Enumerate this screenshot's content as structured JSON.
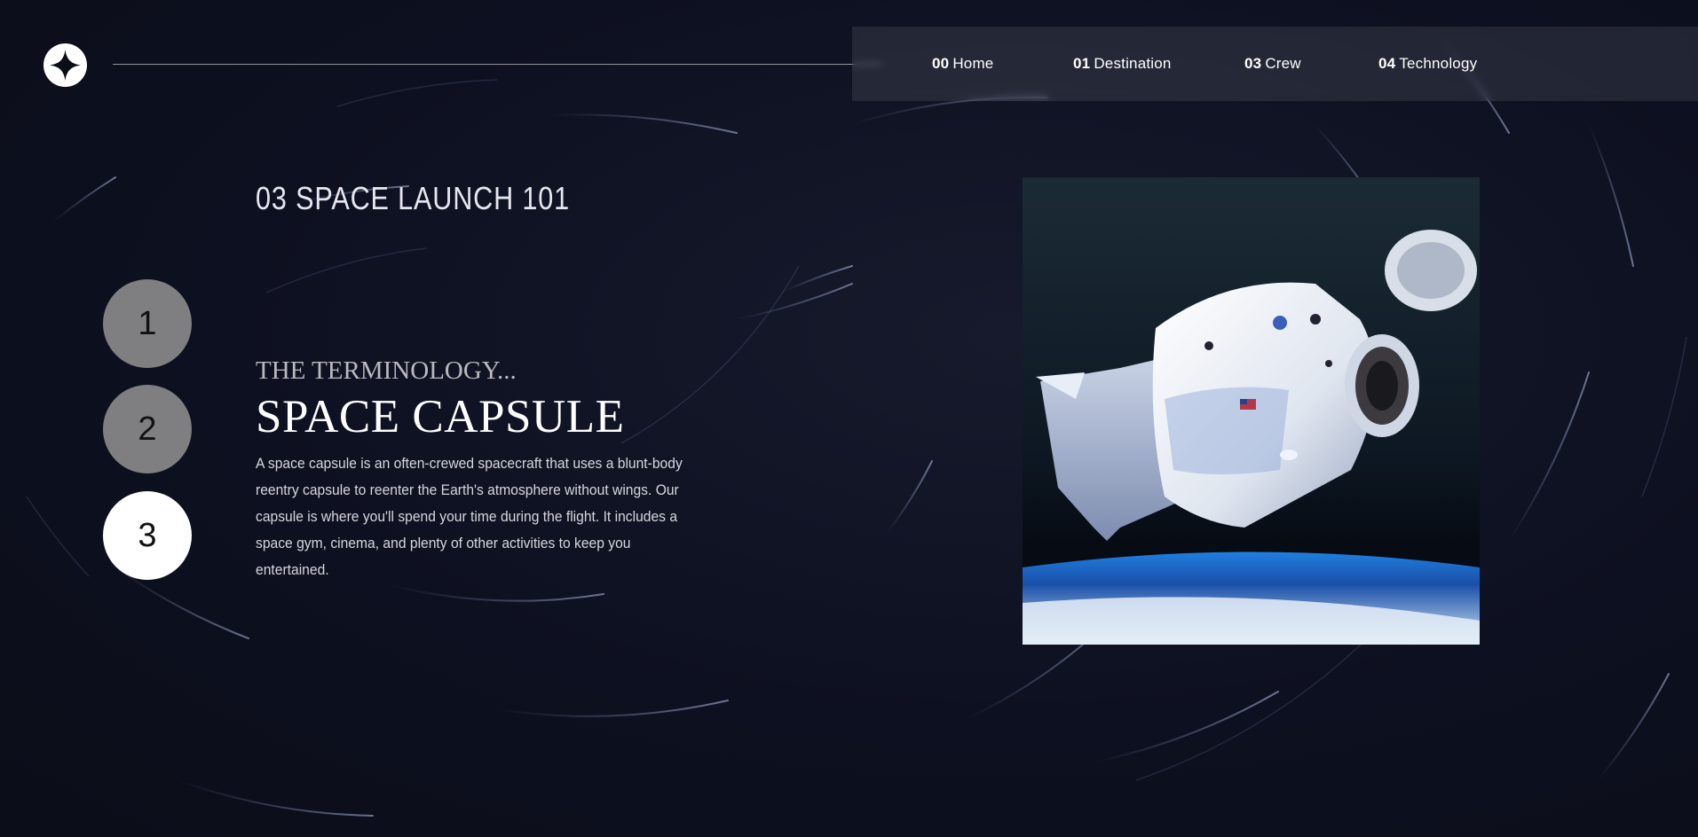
{
  "nav": {
    "items": [
      {
        "num": "00",
        "label": "Home"
      },
      {
        "num": "01",
        "label": "Destination"
      },
      {
        "num": "03",
        "label": "Crew"
      },
      {
        "num": "04",
        "label": "Technology"
      }
    ]
  },
  "page": {
    "heading": "03 SPACE LAUNCH 101"
  },
  "steps": [
    "1",
    "2",
    "3"
  ],
  "active_step": "3",
  "technology": {
    "label": "THE TERMINOLOGY...",
    "title": "SPACE CAPSULE",
    "description": "A space capsule is an often-crewed spacecraft that uses a blunt-body reentry capsule to reenter the Earth's atmosphere without wings. Our capsule is where you'll spend your time during the flight. It includes a space gym, cinema, and plenty of other activities to keep you entertained."
  },
  "icons": {
    "logo": "star-logo-icon"
  },
  "colors": {
    "background": "#0d1020",
    "step_inactive": "#7f7f81",
    "step_active": "#ffffff"
  }
}
